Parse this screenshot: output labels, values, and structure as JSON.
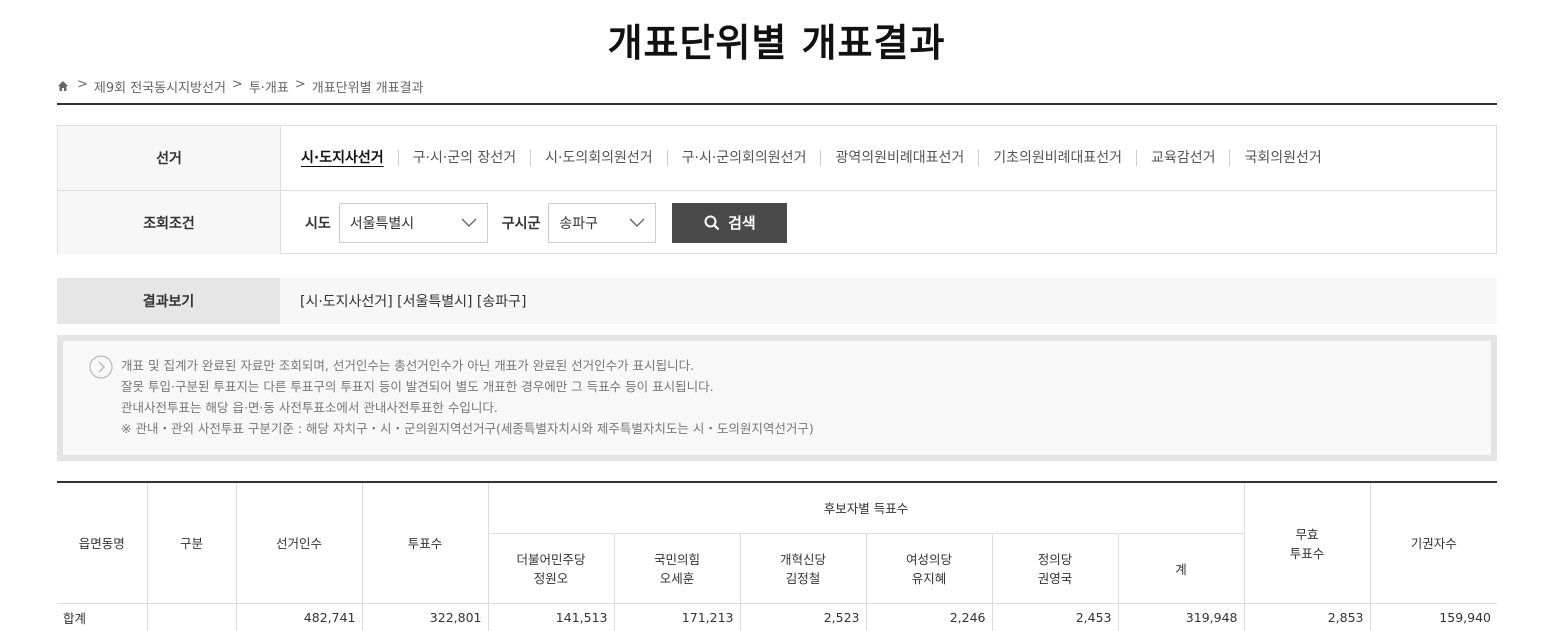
{
  "page": {
    "title": "개표단위별 개표결과"
  },
  "breadcrumb": {
    "items": [
      "제9회 전국동시지방선거",
      "투·개표",
      "개표단위별 개표결과"
    ],
    "separator": ">"
  },
  "filter": {
    "election_label": "선거",
    "elections": [
      {
        "label": "시·도지사선거",
        "active": true
      },
      {
        "label": "구·시·군의 장선거",
        "active": false
      },
      {
        "label": "시·도의회의원선거",
        "active": false
      },
      {
        "label": "구·시·군의회의원선거",
        "active": false
      },
      {
        "label": "광역의원비례대표선거",
        "active": false
      },
      {
        "label": "기초의원비례대표선거",
        "active": false
      },
      {
        "label": "교육감선거",
        "active": false
      },
      {
        "label": "국회의원선거",
        "active": false
      }
    ],
    "condition_label": "조회조건",
    "sido_label": "시도",
    "sido_value": "서울특별시",
    "gusigun_label": "구시군",
    "gusigun_value": "송파구",
    "search_label": "검색"
  },
  "result_view": {
    "label": "결과보기",
    "text": "[시·도지사선거] [서울특별시] [송파구]"
  },
  "notice": {
    "lines": [
      "개표 및 집계가 완료된 자료만 조회되며, 선거인수는 총선거인수가 아닌 개표가 완료된 선거인수가 표시됩니다.",
      "잘못 투입·구분된 투표지는 다른 투표구의 투표지 등이 발견되어 별도 개표한 경우에만 그 득표수 등이 표시됩니다.",
      "관내사전투표는 해당 읍·면·동 사전투표소에서 관내사전투표한 수입니다.",
      "※ 관내・관외 사전투표 구분기준 : 해당 자치구・시・군의원지역선거구(세종특별자치시와 제주특별자치도는 시・도의원지역선거구)"
    ]
  },
  "table": {
    "headers": {
      "district": "읍면동명",
      "category": "구분",
      "electors": "선거인수",
      "votes": "투표수",
      "candidate_group": "후보자별 득표수",
      "candidates": [
        {
          "party": "더불어민주당",
          "name": "정원오"
        },
        {
          "party": "국민의힘",
          "name": "오세훈"
        },
        {
          "party": "개혁신당",
          "name": "김정철"
        },
        {
          "party": "여성의당",
          "name": "유지혜"
        },
        {
          "party": "정의당",
          "name": "권영국"
        }
      ],
      "total": "계",
      "invalid_line1": "무효",
      "invalid_line2": "투표수",
      "abstain": "기권자수"
    },
    "rows": [
      {
        "district": "합계",
        "category": "",
        "electors": "482,741",
        "votes": "322,801",
        "candidate_votes": [
          "141,513",
          "171,213",
          "2,523",
          "2,246",
          "2,453"
        ],
        "total": "319,948",
        "invalid": "2,853",
        "abstain": "159,940"
      }
    ]
  }
}
